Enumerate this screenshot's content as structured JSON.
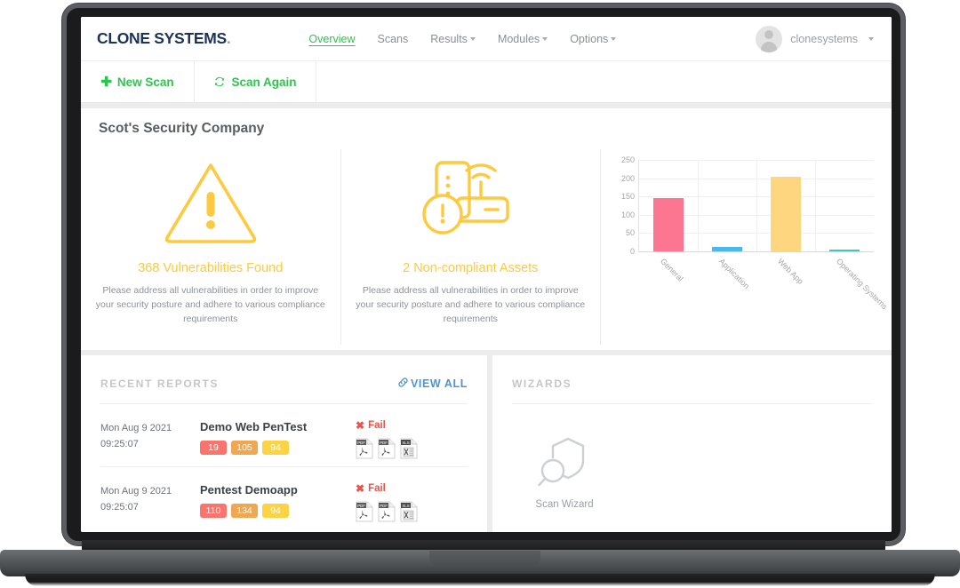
{
  "brand": {
    "logo_text": "CLONE SYSTEMS",
    "logo_dot": ".",
    "accent_green": "#2fc44d",
    "navy": "#1c3359",
    "warning_yellow": "#fdca3f",
    "link_blue": "#4d94d6",
    "fail_red": "#e8544a"
  },
  "navbar": {
    "links": [
      {
        "label": "Overview",
        "active": true,
        "has_caret": false
      },
      {
        "label": "Scans",
        "active": false,
        "has_caret": false
      },
      {
        "label": "Results",
        "active": false,
        "has_caret": true
      },
      {
        "label": "Modules",
        "active": false,
        "has_caret": true
      },
      {
        "label": "Options",
        "active": false,
        "has_caret": true
      }
    ],
    "user": "clonesystems",
    "user_caret": "▾",
    "avatar_icon": "user-avatar-icon"
  },
  "toolbar": {
    "new_scan_label": "New Scan",
    "new_scan_icon": "plus-icon",
    "scan_again_label": "Scan Again",
    "scan_again_icon": "refresh-icon"
  },
  "summary": {
    "company_title": "Scot's Security Company",
    "cards": [
      {
        "icon": "warning-triangle-icon",
        "headline": "368 Vulnerabilities Found",
        "description": "Please address all vulnerabilities in order to improve your security posture and adhere to various compliance requirements"
      },
      {
        "icon": "server-wifi-alert-icon",
        "headline": "2 Non-compliant Assets",
        "description": "Please address all vulnerabilities in order to improve your security posture and adhere to various compliance requirements"
      }
    ]
  },
  "chart_data": {
    "type": "bar",
    "title": "",
    "xlabel": "",
    "ylabel": "",
    "categories": [
      "General",
      "Application",
      "Web App",
      "Operating Systems"
    ],
    "values": [
      145,
      12,
      205,
      3
    ],
    "colors": [
      "#fc7691",
      "#4cb8ea",
      "#fdd67f",
      "#3ec7c2"
    ],
    "ylim": [
      0,
      250
    ],
    "yticks": [
      0,
      50,
      100,
      150,
      200,
      250
    ],
    "grid": true,
    "legend": false
  },
  "reports_panel": {
    "title": "RECENT REPORTS",
    "view_all_label": "VIEW ALL",
    "view_all_icon": "link-chain-icon",
    "rows": [
      {
        "date": "Mon Aug 9 2021",
        "time": "09:25:07",
        "name": "Demo Web PenTest",
        "badges": [
          {
            "value": "19",
            "color": "#f9746d"
          },
          {
            "value": "105",
            "color": "#f0a752"
          },
          {
            "value": "94",
            "color": "#fbd344"
          }
        ],
        "status": "Fail",
        "status_icon": "x-mark-icon",
        "files": [
          "pdf-file-icon",
          "pdf-file-icon",
          "xls-file-icon"
        ],
        "file_labels": [
          "PDF",
          "PDF",
          "XLS"
        ]
      },
      {
        "date": "Mon Aug 9 2021",
        "time": "09:25:07",
        "name": "Pentest Demoapp",
        "badges": [
          {
            "value": "110",
            "color": "#f9746d"
          },
          {
            "value": "134",
            "color": "#f0a752"
          },
          {
            "value": "94",
            "color": "#fbd344"
          }
        ],
        "status": "Fail",
        "status_icon": "x-mark-icon",
        "files": [
          "pdf-file-icon",
          "pdf-file-icon",
          "xls-file-icon"
        ],
        "file_labels": [
          "PDF",
          "PDF",
          "XLS"
        ]
      }
    ]
  },
  "wizards_panel": {
    "title": "WIZARDS",
    "items": [
      {
        "label": "Scan Wizard",
        "icon": "shield-magnifier-icon"
      }
    ]
  }
}
